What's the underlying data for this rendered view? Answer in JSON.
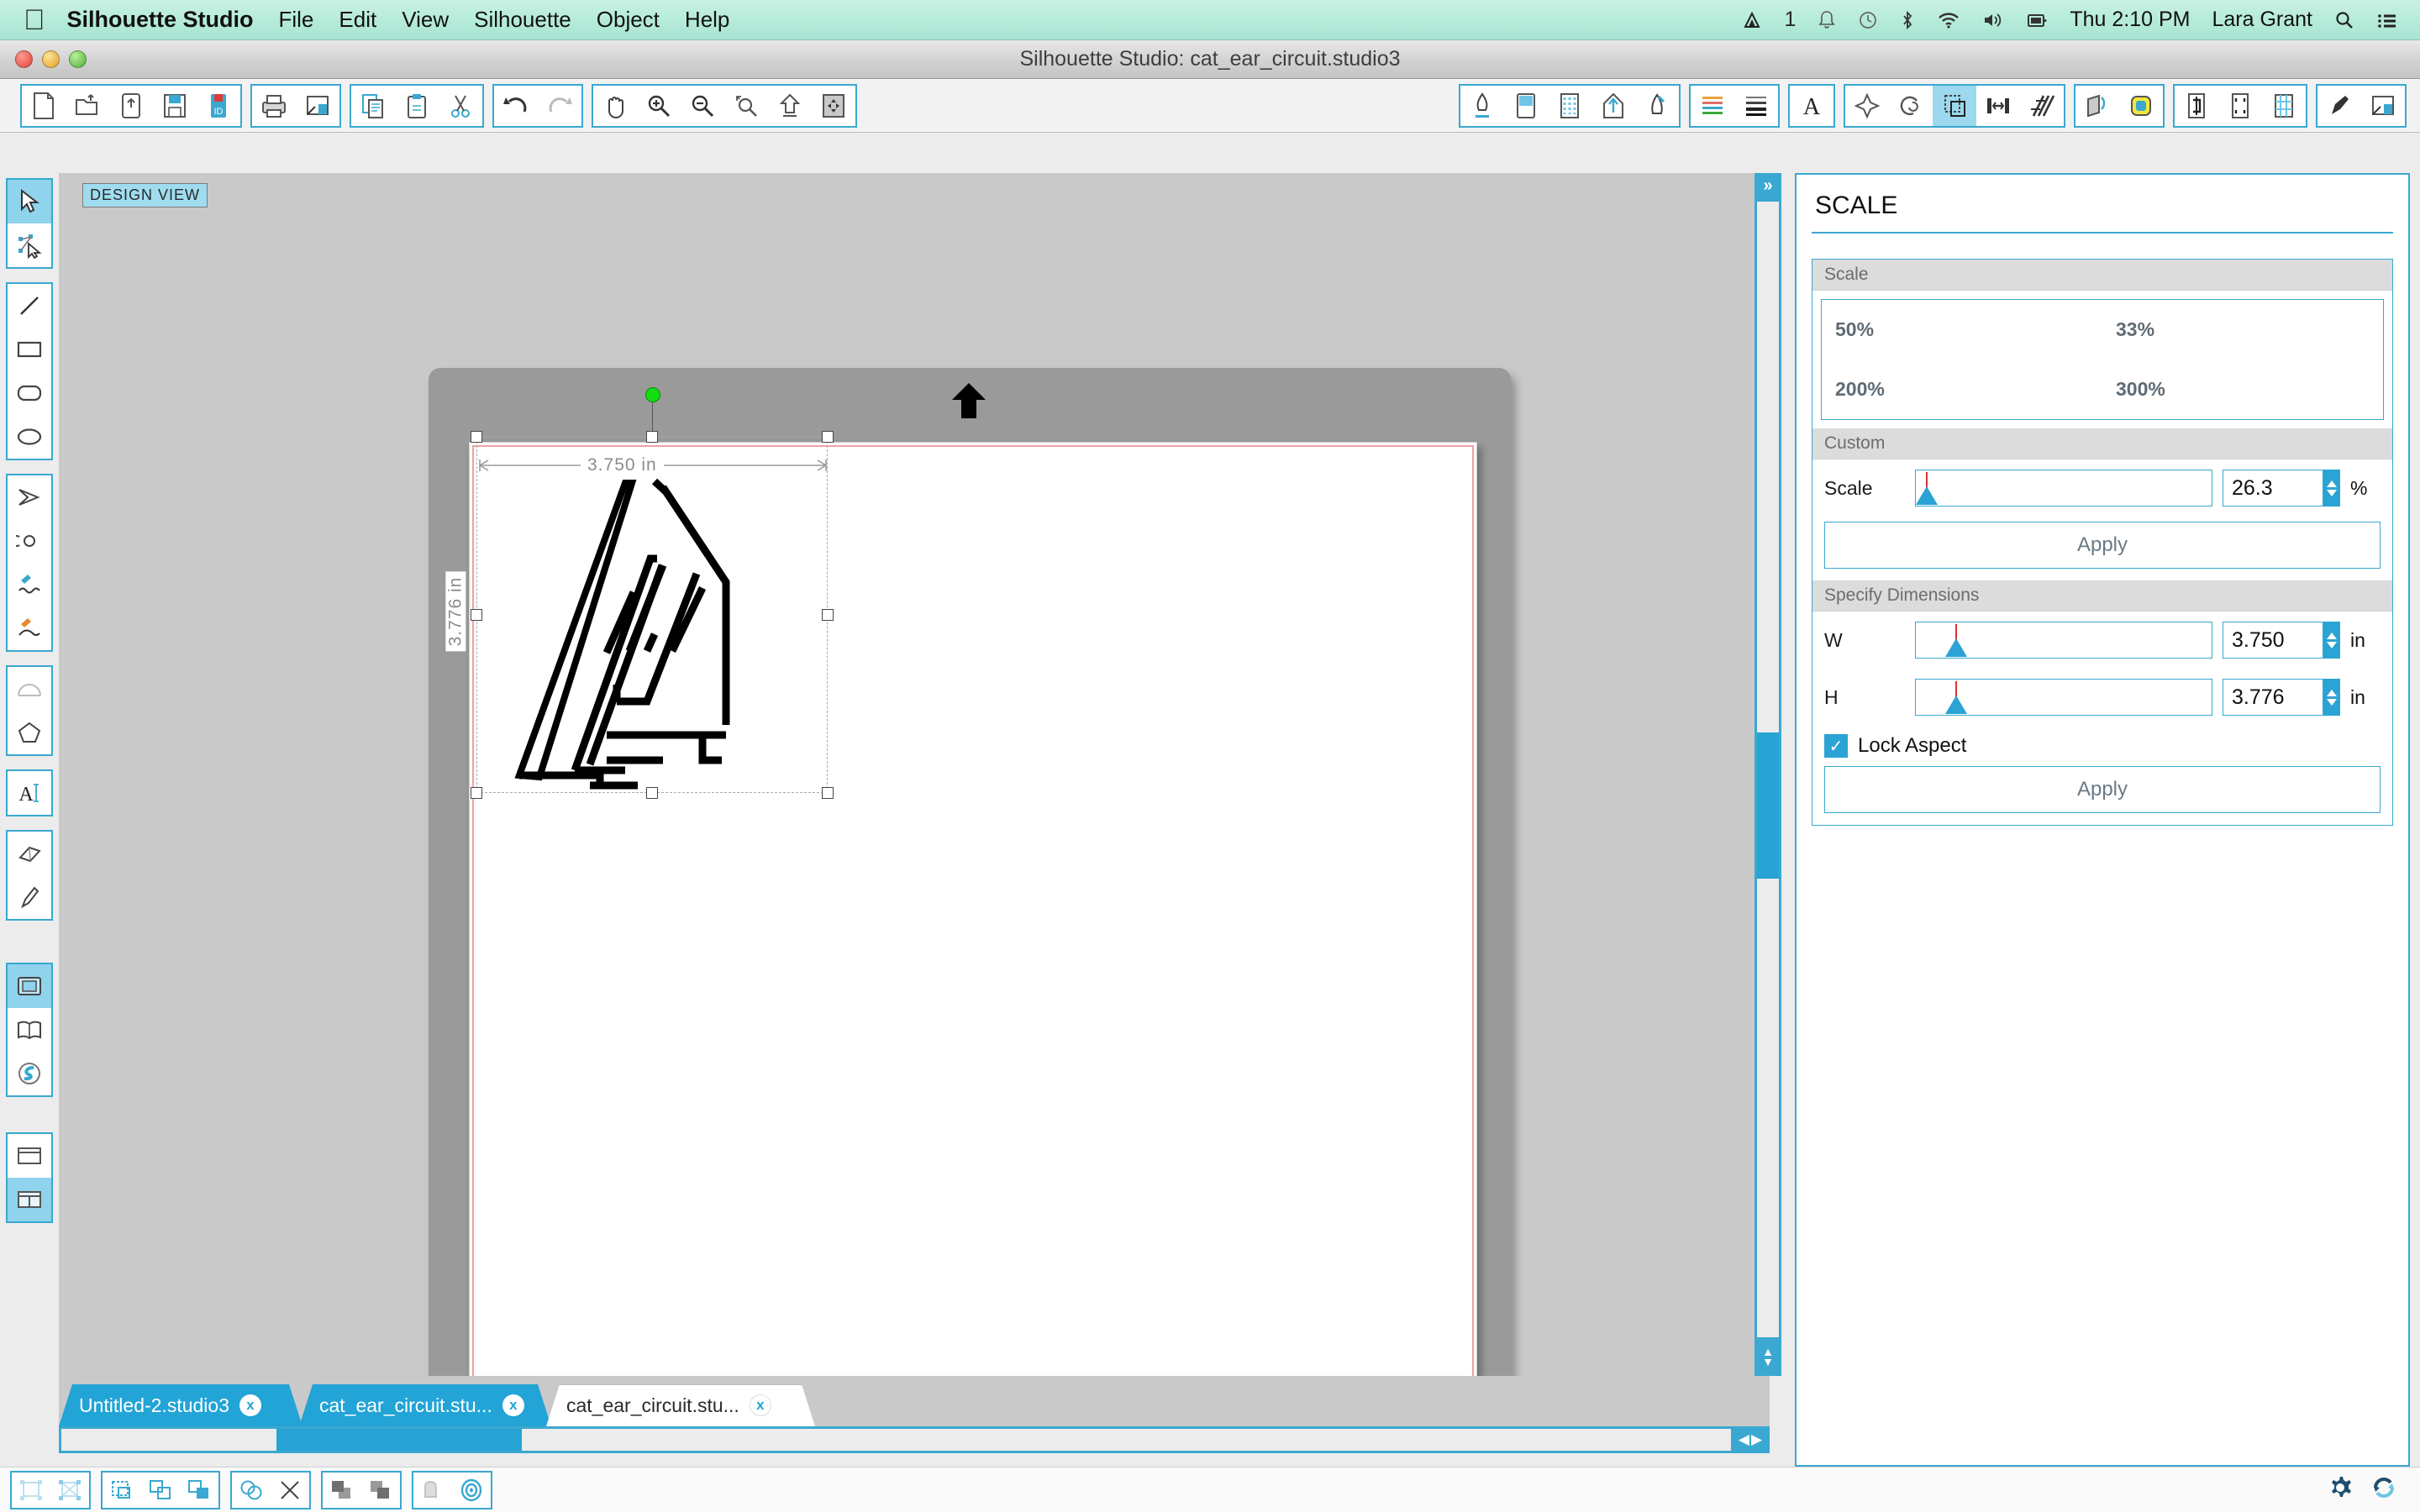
{
  "menubar": {
    "apple_glyph": "",
    "app_name": "Silhouette Studio",
    "items": [
      {
        "label": "File"
      },
      {
        "label": "Edit"
      },
      {
        "label": "View"
      },
      {
        "label": "Silhouette"
      },
      {
        "label": "Object"
      },
      {
        "label": "Help"
      }
    ],
    "status_badge": "1",
    "clock": "Thu 2:10 PM",
    "user": "Lara Grant",
    "icons": [
      "app-indicator-icon",
      "bell-icon",
      "time-machine-icon",
      "bluetooth-icon",
      "wifi-icon",
      "volume-icon",
      "display-icon",
      "search-icon",
      "notification-center-icon"
    ]
  },
  "window": {
    "title": "Silhouette Studio: cat_ear_circuit.studio3",
    "traffic_lights": [
      "close",
      "minimize",
      "zoom"
    ]
  },
  "toolbar": {
    "left_groups": [
      [
        "new-document-icon",
        "open-document-icon",
        "save-as-icon",
        "save-icon",
        "store-download-icon"
      ],
      [
        "print-icon",
        "cut-settings-icon"
      ],
      [
        "copy-icon",
        "paste-icon",
        "cut-scissors-icon"
      ],
      [
        "undo-icon",
        "redo-icon"
      ],
      [
        "pan-hand-icon",
        "zoom-in-icon",
        "zoom-out-icon",
        "zoom-selection-icon",
        "zoom-fit-icon",
        "zoom-all-icon"
      ]
    ],
    "right_groups": [
      [
        "cut-settings-panel-icon",
        "page-setup-icon",
        "registration-marks-icon",
        "send-to-silhouette-icon",
        "pen-holder-icon"
      ],
      [
        "line-style-icon",
        "line-thickness-icon"
      ],
      [
        "text-style-icon"
      ],
      [
        "align-icon",
        "replicate-icon",
        "scale-icon",
        "modify-icon",
        "offset-icon"
      ],
      [
        "trace-icon",
        "fill-color-icon"
      ],
      [
        "knife-panel-icon",
        "mat-panel-icon",
        "grid-panel-icon"
      ],
      [
        "sketch-pen-icon",
        "print-and-cut-icon"
      ]
    ],
    "active_right_tool": "scale-icon"
  },
  "left_rail": {
    "groups": [
      [
        "select-arrow-icon",
        "edit-points-icon"
      ],
      [
        "line-tool-icon",
        "rectangle-tool-icon",
        "rounded-rectangle-tool-icon",
        "ellipse-tool-icon"
      ],
      [
        "polygon-tool-icon",
        "curve-tool-icon",
        "draw-freehand-icon",
        "draw-smooth-icon"
      ],
      [
        "arc-tool-icon",
        "regular-polygon-tool-icon"
      ],
      [
        "text-tool-icon"
      ],
      [
        "eraser-tool-icon",
        "knife-tool-icon"
      ],
      [
        "design-view-icon",
        "library-view-icon",
        "store-view-icon"
      ],
      [
        "single-panel-icon",
        "split-panel-icon"
      ]
    ],
    "active": [
      "select-arrow-icon",
      "design-view-icon",
      "split-panel-icon"
    ]
  },
  "canvas": {
    "view_badge": "DESIGN VIEW",
    "width_dimension": "3.750 in",
    "height_dimension": "3.776 in",
    "rotation_handle": "rotate-handle",
    "mat_orientation_arrow": "mat-up-arrow-icon",
    "artwork_name": "cat-ear-circuit-artwork"
  },
  "panel": {
    "title": "SCALE",
    "scale_section": {
      "header": "Scale",
      "presets": [
        "50%",
        "33%",
        "200%",
        "300%"
      ]
    },
    "custom_section": {
      "header": "Custom",
      "scale_label": "Scale",
      "scale_value": "26.3",
      "scale_unit": "%",
      "apply_label": "Apply"
    },
    "dimensions_section": {
      "header": "Specify Dimensions",
      "w_label": "W",
      "w_value": "3.750",
      "w_unit": "in",
      "h_label": "H",
      "h_value": "3.776",
      "h_unit": "in",
      "lock_aspect_label": "Lock Aspect",
      "lock_aspect_checked": true,
      "check_glyph": "✓",
      "apply_label": "Apply"
    }
  },
  "tabs": [
    {
      "label": "Untitled-2.studio3",
      "close": "x",
      "active": false
    },
    {
      "label": "cat_ear_circuit.stu...",
      "close": "x",
      "active": false
    },
    {
      "label": "cat_ear_circuit.stu...",
      "close": "x",
      "active": true
    }
  ],
  "scrollbars": {
    "collapse_label": "»",
    "v_up_glyph": "▲",
    "v_down_glyph": "▼",
    "h_left_glyph": "◀",
    "h_right_glyph": "▶"
  },
  "statusbar": {
    "groups": [
      [
        "select-all-icon",
        "select-points-icon"
      ],
      [
        "group-icon",
        "duplicate-icon",
        "duplicate-fill-icon"
      ],
      [
        "weld-icon",
        "detach-icon"
      ],
      [
        "bring-to-front-icon",
        "send-to-back-icon"
      ],
      [
        "shadow-icon",
        "offset-target-icon"
      ]
    ],
    "right_icons": [
      "gear-icon",
      "sync-icon"
    ]
  },
  "colors": {
    "accent": "#2ba3d4",
    "accent_border": "#3aa8d0",
    "menubar_top": "#c9f0e2",
    "canvas_bg": "#c9c9c9",
    "mat": "#9a9a9a",
    "cut_border": "#f0a0a0",
    "rotate_handle": "#14dd14"
  }
}
